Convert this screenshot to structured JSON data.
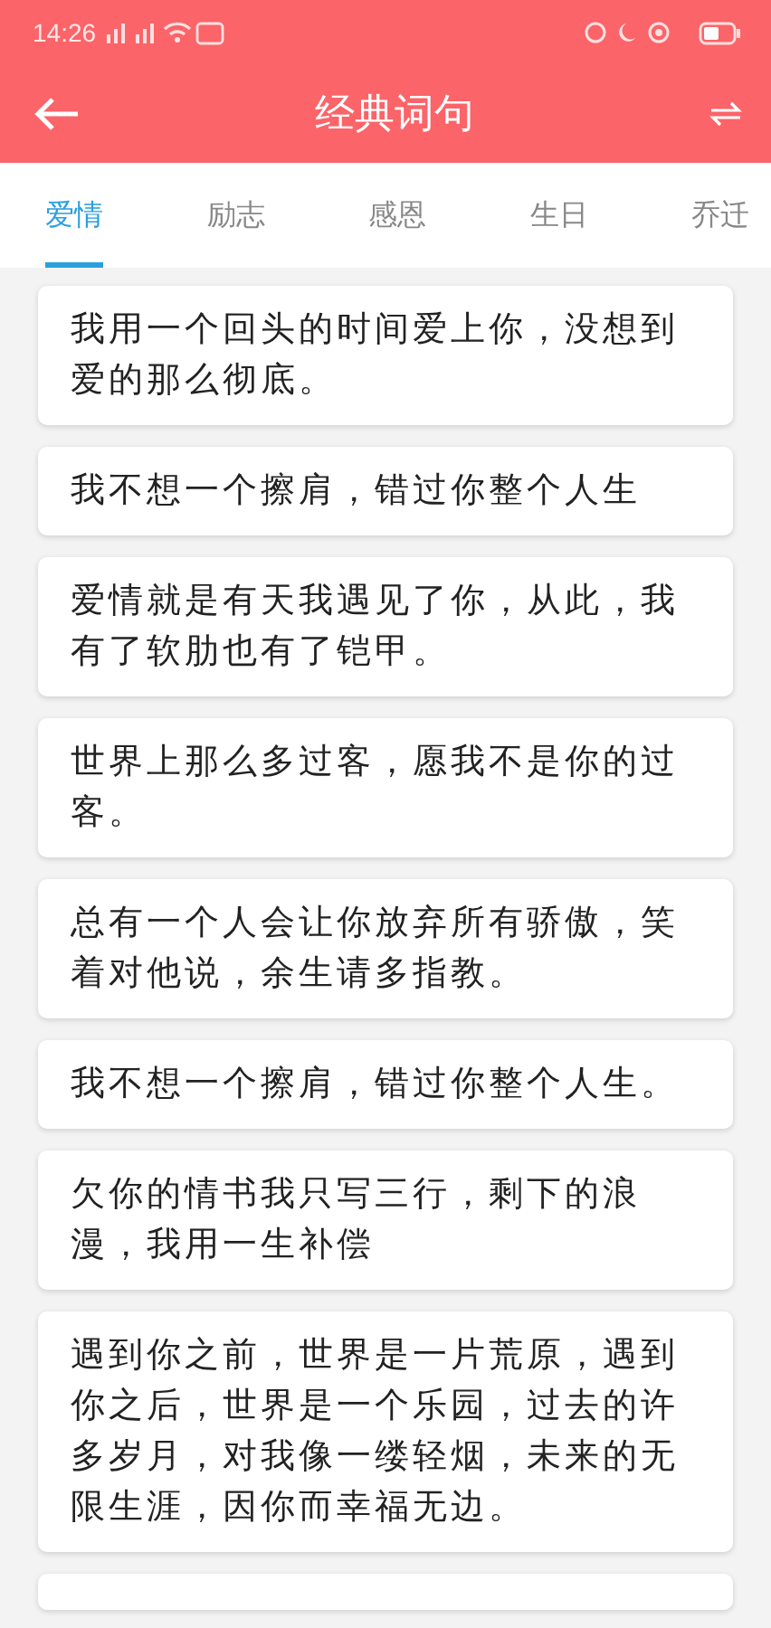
{
  "status_bar": {
    "time": "14:26"
  },
  "header": {
    "title": "经典词句"
  },
  "tabs": [
    {
      "label": "爱情",
      "selected": true
    },
    {
      "label": "励志",
      "selected": false
    },
    {
      "label": "感恩",
      "selected": false
    },
    {
      "label": "生日",
      "selected": false
    },
    {
      "label": "乔迁",
      "selected": false
    }
  ],
  "quotes": [
    "我用一个回头的时间爱上你，没想到爱的那么彻底。",
    "我不想一个擦肩，错过你整个人生",
    "爱情就是有天我遇见了你，从此，我有了软肋也有了铠甲。",
    "世界上那么多过客，愿我不是你的过客。",
    "总有一个人会让你放弃所有骄傲，笑着对他说，余生请多指教。",
    "我不想一个擦肩，错过你整个人生。",
    "欠你的情书我只写三行，剩下的浪漫，我用一生补偿",
    "遇到你之前，世界是一片荒原，遇到你之后，世界是一个乐园，过去的许多岁月，对我像一缕轻烟，未来的无限生涯，因你而幸福无边。"
  ],
  "more_below": true
}
